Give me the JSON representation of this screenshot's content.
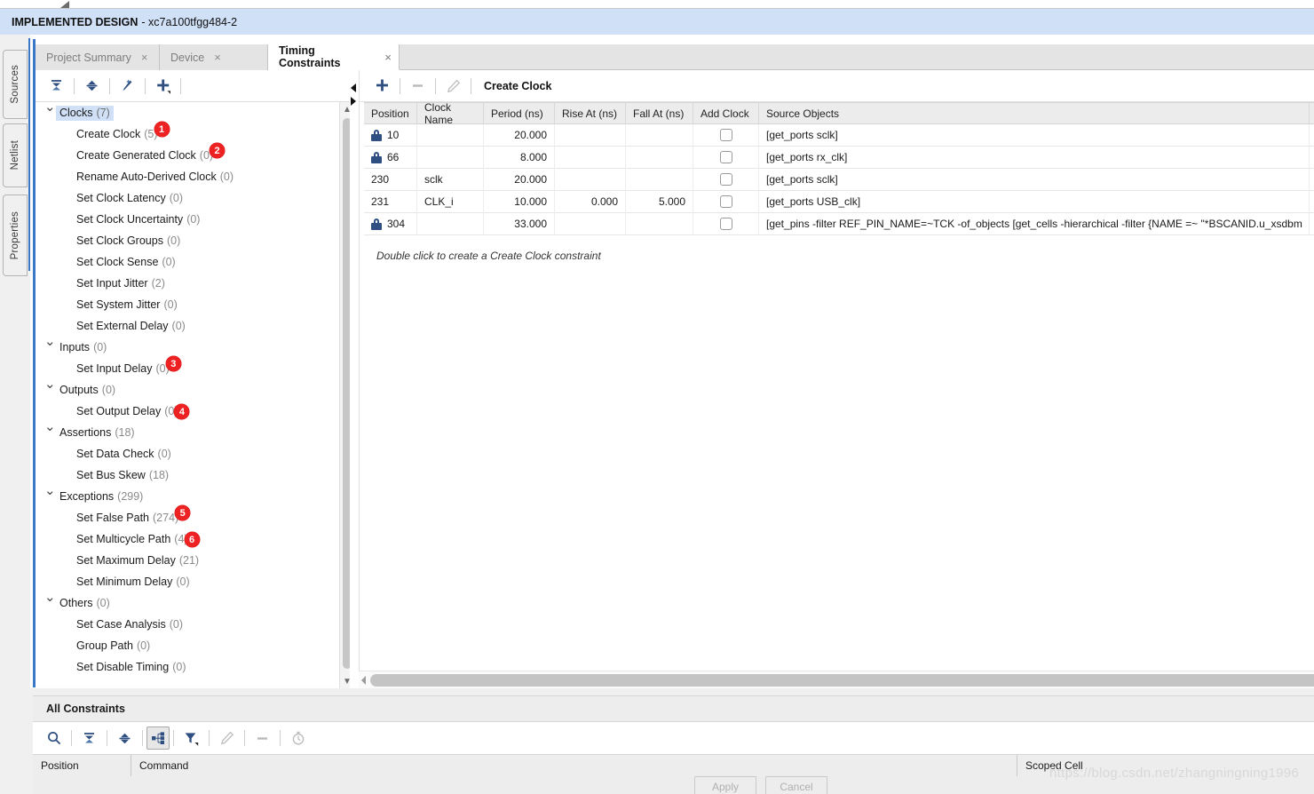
{
  "window": {
    "impl_title": "IMPLEMENTED DESIGN",
    "impl_subtitle": "- xc7a100tfgg484-2"
  },
  "vertical_tabs": [
    {
      "label": "Sources"
    },
    {
      "label": "Netlist"
    },
    {
      "label": "Properties"
    }
  ],
  "tabs": [
    {
      "label": "Project Summary",
      "close": "×",
      "active": false
    },
    {
      "label": "Device",
      "close": "×",
      "active": false
    },
    {
      "label": "Timing Constraints",
      "close": "×",
      "active": true
    }
  ],
  "tree_toolbar": [
    {
      "name": "collapse-all-icon"
    },
    {
      "name": "expand-collapse-icon"
    },
    {
      "name": "magic-wand-icon"
    },
    {
      "name": "add-constraint-icon"
    }
  ],
  "tree": [
    {
      "type": "group",
      "label": "Clocks",
      "count": "(7)",
      "selected": true,
      "badge": null
    },
    {
      "type": "child",
      "label": "Create Clock",
      "count": "(5)",
      "selected": false,
      "badge": "1"
    },
    {
      "type": "child",
      "label": "Create Generated Clock",
      "count": "(0)",
      "selected": false,
      "badge": "2"
    },
    {
      "type": "child",
      "label": "Rename Auto-Derived Clock",
      "count": "(0)",
      "selected": false,
      "badge": null
    },
    {
      "type": "child",
      "label": "Set Clock Latency",
      "count": "(0)",
      "selected": false,
      "badge": null
    },
    {
      "type": "child",
      "label": "Set Clock Uncertainty",
      "count": "(0)",
      "selected": false,
      "badge": null
    },
    {
      "type": "child",
      "label": "Set Clock Groups",
      "count": "(0)",
      "selected": false,
      "badge": null
    },
    {
      "type": "child",
      "label": "Set Clock Sense",
      "count": "(0)",
      "selected": false,
      "badge": null
    },
    {
      "type": "child",
      "label": "Set Input Jitter",
      "count": "(2)",
      "selected": false,
      "badge": null
    },
    {
      "type": "child",
      "label": "Set System Jitter",
      "count": "(0)",
      "selected": false,
      "badge": null
    },
    {
      "type": "child",
      "label": "Set External Delay",
      "count": "(0)",
      "selected": false,
      "badge": null
    },
    {
      "type": "group",
      "label": "Inputs",
      "count": "(0)",
      "selected": false,
      "badge": null
    },
    {
      "type": "child",
      "label": "Set Input Delay",
      "count": "(0)",
      "selected": false,
      "badge": "3"
    },
    {
      "type": "group",
      "label": "Outputs",
      "count": "(0)",
      "selected": false,
      "badge": null
    },
    {
      "type": "child",
      "label": "Set Output Delay",
      "count": "(0)",
      "selected": false,
      "badge": "4"
    },
    {
      "type": "group",
      "label": "Assertions",
      "count": "(18)",
      "selected": false,
      "badge": null
    },
    {
      "type": "child",
      "label": "Set Data Check",
      "count": "(0)",
      "selected": false,
      "badge": null
    },
    {
      "type": "child",
      "label": "Set Bus Skew",
      "count": "(18)",
      "selected": false,
      "badge": null
    },
    {
      "type": "group",
      "label": "Exceptions",
      "count": "(299)",
      "selected": false,
      "badge": null
    },
    {
      "type": "child",
      "label": "Set False Path",
      "count": "(274)",
      "selected": false,
      "badge": "5"
    },
    {
      "type": "child",
      "label": "Set Multicycle Path",
      "count": "(4)",
      "selected": false,
      "badge": "6"
    },
    {
      "type": "child",
      "label": "Set Maximum Delay",
      "count": "(21)",
      "selected": false,
      "badge": null
    },
    {
      "type": "child",
      "label": "Set Minimum Delay",
      "count": "(0)",
      "selected": false,
      "badge": null
    },
    {
      "type": "group",
      "label": "Others",
      "count": "(0)",
      "selected": false,
      "badge": null
    },
    {
      "type": "child",
      "label": "Set Case Analysis",
      "count": "(0)",
      "selected": false,
      "badge": null
    },
    {
      "type": "child",
      "label": "Group Path",
      "count": "(0)",
      "selected": false,
      "badge": null
    },
    {
      "type": "child",
      "label": "Set Disable Timing",
      "count": "(0)",
      "selected": false,
      "badge": null
    }
  ],
  "right_pane": {
    "title": "Create Clock",
    "toolbar": [
      {
        "name": "add-icon",
        "enabled": true
      },
      {
        "name": "remove-icon",
        "enabled": false
      },
      {
        "name": "edit-pencil-icon",
        "enabled": false
      }
    ],
    "columns": [
      "Position",
      "Clock Name",
      "Period (ns)",
      "Rise At (ns)",
      "Fall At (ns)",
      "Add Clock",
      "Source Objects"
    ],
    "rows": [
      {
        "locked": true,
        "position": "10",
        "clock_name": "",
        "period": "20.000",
        "rise_at": "",
        "fall_at": "",
        "add_clock": false,
        "source": "[get_ports sclk]"
      },
      {
        "locked": true,
        "position": "66",
        "clock_name": "",
        "period": "8.000",
        "rise_at": "",
        "fall_at": "",
        "add_clock": false,
        "source": "[get_ports rx_clk]"
      },
      {
        "locked": false,
        "position": "230",
        "clock_name": "sclk",
        "period": "20.000",
        "rise_at": "",
        "fall_at": "",
        "add_clock": false,
        "source": "[get_ports sclk]"
      },
      {
        "locked": false,
        "position": "231",
        "clock_name": "CLK_i",
        "period": "10.000",
        "rise_at": "0.000",
        "fall_at": "5.000",
        "add_clock": false,
        "source": "[get_ports USB_clk]"
      },
      {
        "locked": true,
        "position": "304",
        "clock_name": "",
        "period": "33.000",
        "rise_at": "",
        "fall_at": "",
        "add_clock": false,
        "source": "[get_pins -filter REF_PIN_NAME=~TCK -of_objects [get_cells -hierarchical -filter {NAME =~ \"*BSCANID.u_xsdbm"
      }
    ],
    "hint": "Double click to create a Create Clock constraint"
  },
  "bottom": {
    "panel_title": "All Constraints",
    "toolbar": [
      {
        "name": "search-icon",
        "enabled": true,
        "selected": false
      },
      {
        "name": "collapse-all-icon",
        "enabled": true,
        "selected": false
      },
      {
        "name": "expand-all-icon",
        "enabled": true,
        "selected": false
      },
      {
        "name": "hierarchy-icon",
        "enabled": true,
        "selected": true
      },
      {
        "name": "filter-icon",
        "enabled": true,
        "selected": false
      },
      {
        "name": "edit-pencil-icon",
        "enabled": false,
        "selected": false
      },
      {
        "name": "remove-icon",
        "enabled": false,
        "selected": false
      },
      {
        "name": "timer-icon",
        "enabled": false,
        "selected": false
      }
    ],
    "columns": {
      "position": "Position",
      "command": "Command",
      "scoped_cell": "Scoped Cell"
    },
    "apply_label": "Apply",
    "cancel_label": "Cancel"
  },
  "watermark": "https://blog.csdn.net/zhangningning1996",
  "colors": {
    "accent_blue": "#3c78c8",
    "banner_blue": "#cfe0f7",
    "icon_blue": "#2f4f82",
    "badge_red": "#ee2222"
  }
}
